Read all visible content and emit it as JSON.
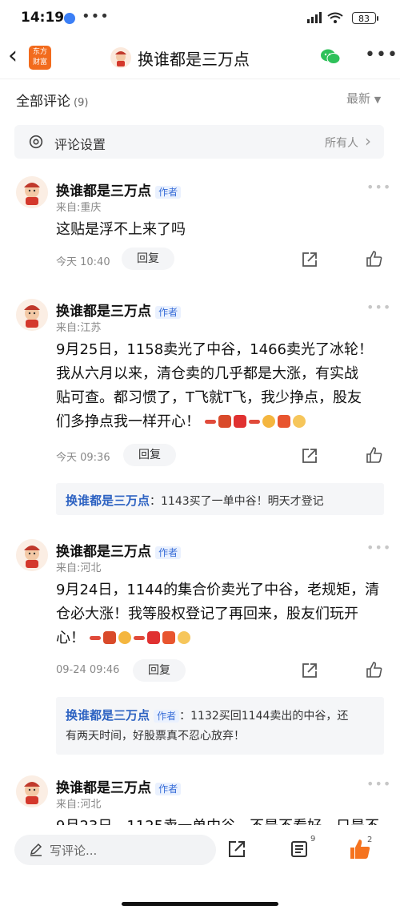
{
  "status": {
    "time": "14:19",
    "battery": "83"
  },
  "header": {
    "title": "换谁都是三万点",
    "logo_line1": "东方",
    "logo_line2": "财富"
  },
  "comments_header": {
    "label": "全部评论",
    "count": "(9)",
    "sort": "最新"
  },
  "settings": {
    "label": "评论设置",
    "value": "所有人"
  },
  "comments": [
    {
      "name": "换谁都是三万点",
      "badge": "作者",
      "origin": "来自:重庆",
      "text": "这贴是浮不上来了吗",
      "time": "今天 10:40",
      "reply": "回复"
    },
    {
      "name": "换谁都是三万点",
      "badge": "作者",
      "origin": "来自:江苏",
      "line1": "9月25日，1158卖光了中谷，1466卖光了冰轮！",
      "line2": "我从六月以来，清仓卖的几乎都是大涨，有实战",
      "line3": "贴可查。都习惯了，T飞就T飞，我少挣点，股友",
      "line4": "们多挣点我一样开心！",
      "time": "今天 09:36",
      "reply": "回复",
      "sub_name": "换谁都是三万点",
      "sub_text": "：1143买了一单中谷！明天才登记"
    },
    {
      "name": "换谁都是三万点",
      "badge": "作者",
      "origin": "来自:河北",
      "line1": "9月24日，1144的集合价卖光了中谷，老规矩，清",
      "line2": "仓必大涨！我等股权登记了再回来，股友们玩开",
      "line3": "心！",
      "time": "09-24 09:46",
      "reply": "回复",
      "sub_name": "换谁都是三万点",
      "sub_badge": "作者",
      "sub_text1": "：1132买回1144卖出的中谷，还",
      "sub_text2": "有两天时间，好股票真不忍心放弃！"
    },
    {
      "name": "换谁都是三万点",
      "badge": "作者",
      "origin": "来自:河北",
      "line1": "9月23日，1125卖一单中谷，不是不看好，只是不"
    }
  ],
  "bottom": {
    "placeholder": "写评论...",
    "comment_count": "9",
    "like_count": "2"
  },
  "colors": {
    "accent": "#2d62c2",
    "brand": "#f26b1d",
    "like": "#f5731f"
  }
}
